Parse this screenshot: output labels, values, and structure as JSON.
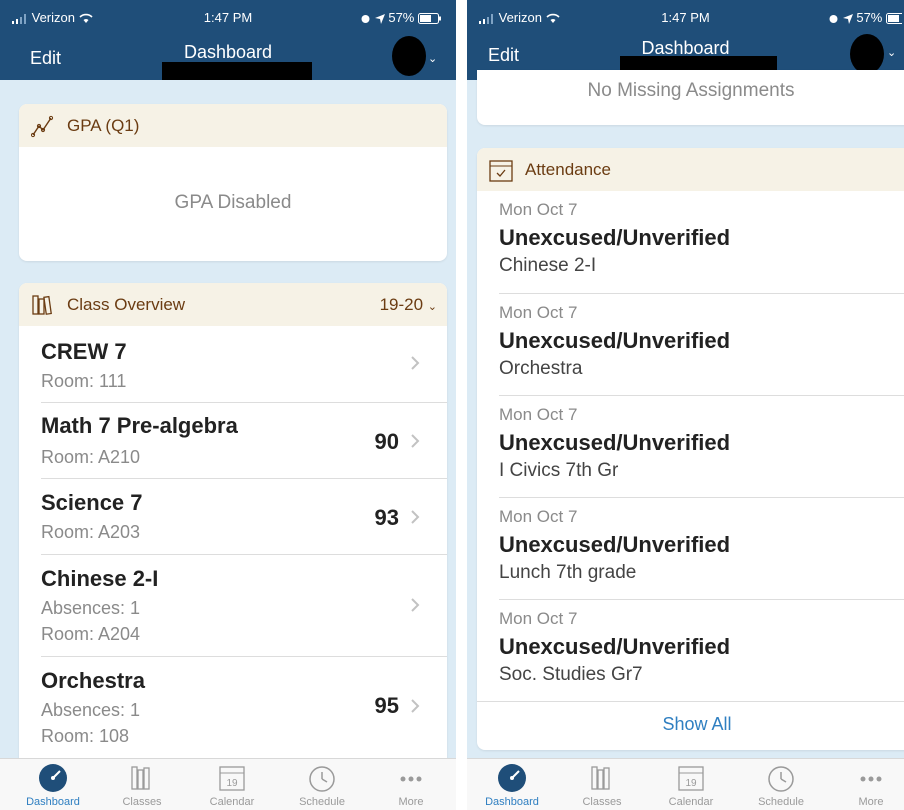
{
  "status_bar": {
    "carrier": "Verizon",
    "time": "1:47 PM",
    "battery": "57%"
  },
  "nav": {
    "edit_label": "Edit",
    "title": "Dashboard"
  },
  "gpa_card": {
    "title": "GPA (Q1)",
    "message": "GPA Disabled"
  },
  "class_overview": {
    "title": "Class Overview",
    "term": "19-20",
    "classes": [
      {
        "name": "CREW 7",
        "details": [
          "Room: 111"
        ],
        "grade": ""
      },
      {
        "name": "Math 7 Pre-algebra",
        "details": [
          "Room: A210"
        ],
        "grade": "90"
      },
      {
        "name": "Science 7",
        "details": [
          "Room: A203"
        ],
        "grade": "93"
      },
      {
        "name": "Chinese 2-I",
        "details": [
          "Absences: 1",
          "Room: A204"
        ],
        "grade": ""
      },
      {
        "name": "Orchestra",
        "details": [
          "Absences: 1",
          "Room: 108"
        ],
        "grade": "95"
      }
    ]
  },
  "missing_card": {
    "message": "No Missing Assignments"
  },
  "attendance": {
    "title": "Attendance",
    "entries": [
      {
        "date": "Mon Oct 7",
        "status": "Unexcused/Unverified",
        "class": "Chinese 2-I"
      },
      {
        "date": "Mon Oct 7",
        "status": "Unexcused/Unverified",
        "class": "Orchestra"
      },
      {
        "date": "Mon Oct 7",
        "status": "Unexcused/Unverified",
        "class": "I Civics 7th Gr"
      },
      {
        "date": "Mon Oct 7",
        "status": "Unexcused/Unverified",
        "class": "Lunch 7th grade"
      },
      {
        "date": "Mon Oct 7",
        "status": "Unexcused/Unverified",
        "class": "Soc. Studies Gr7"
      }
    ],
    "show_all_label": "Show All"
  },
  "tabs": [
    {
      "label": "Dashboard",
      "icon": "dashboard-icon",
      "active": true
    },
    {
      "label": "Classes",
      "icon": "books-icon",
      "active": false
    },
    {
      "label": "Calendar",
      "icon": "calendar-icon",
      "active": false,
      "icon_text": "19"
    },
    {
      "label": "Schedule",
      "icon": "clock-icon",
      "active": false
    },
    {
      "label": "More",
      "icon": "more-icon",
      "active": false
    }
  ],
  "colors": {
    "nav_blue": "#1f4e79",
    "accent_blue": "#2f7fc1",
    "header_brown": "#6b3c12",
    "header_bg": "#f6f2e6",
    "page_bg": "#dcebf5"
  }
}
